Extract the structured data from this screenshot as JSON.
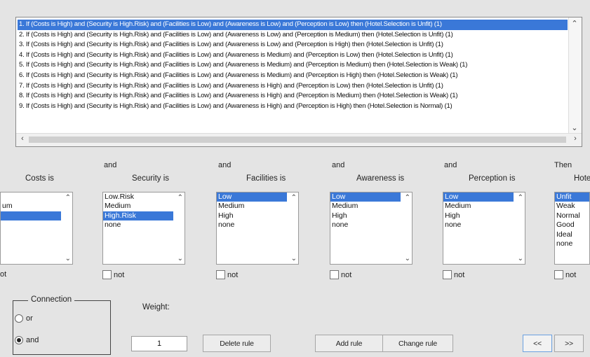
{
  "rules": {
    "items": [
      "1. If (Costs is High) and (Security is High.Risk) and (Facilities is Low) and (Awareness is Low) and (Perception is Low) then (Hotel.Selection is Unfit) (1)",
      "2. If (Costs is High) and (Security is High.Risk) and (Facilities is Low) and (Awareness is Low) and (Perception is Medium) then (Hotel.Selection is Unfit) (1)",
      "3. If (Costs is High) and (Security is High.Risk) and (Facilities is Low) and (Awareness is Low) and (Perception is High) then (Hotel.Selection is Unfit) (1)",
      "4. If (Costs is High) and (Security is High.Risk) and (Facilities is Low) and (Awareness is Medium) and (Perception is Low) then (Hotel.Selection is Unfit) (1)",
      "5. If (Costs is High) and (Security is High.Risk) and (Facilities is Low) and (Awareness is Medium) and (Perception is Medium) then (Hotel.Selection is Weak) (1)",
      "6. If (Costs is High) and (Security is High.Risk) and (Facilities is Low) and (Awareness is Medium) and (Perception is High) then (Hotel.Selection is Weak) (1)",
      "7. If (Costs is High) and (Security is High.Risk) and (Facilities is Low) and (Awareness is High) and (Perception is Low) then (Hotel.Selection is Unfit) (1)",
      "8. If (Costs is High) and (Security is High.Risk) and (Facilities is Low) and (Awareness is High) and (Perception is Medium) then (Hotel.Selection is Weak) (1)",
      "9. If (Costs is High) and (Security is High.Risk) and (Facilities is Low) and (Awareness is High) and (Perception is High) then (Hotel.Selection is Normal) (1)"
    ],
    "selected_index": 0
  },
  "columns": {
    "costs": {
      "title": "Costs is",
      "options": [
        "",
        "um",
        ""
      ],
      "selected": 2,
      "not_label": "ot"
    },
    "security": {
      "header": "and",
      "title": "Security is",
      "options": [
        "Low.Risk",
        "Medium",
        "High.Risk",
        "none"
      ],
      "selected": 2,
      "not_label": "not"
    },
    "facilities": {
      "header": "and",
      "title": "Facilities is",
      "options": [
        "Low",
        "Medium",
        "High",
        "none"
      ],
      "selected": 0,
      "not_label": "not"
    },
    "awareness": {
      "header": "and",
      "title": "Awareness is",
      "options": [
        "Low",
        "Medium",
        "High",
        "none"
      ],
      "selected": 0,
      "not_label": "not"
    },
    "perception": {
      "header": "and",
      "title": "Perception is",
      "options": [
        "Low",
        "Medium",
        "High",
        "none"
      ],
      "selected": 0,
      "not_label": "not"
    },
    "hotel": {
      "header": "Then",
      "title": "Hote",
      "options": [
        "Unfit",
        "Weak",
        "Normal",
        "Good",
        "Ideal",
        "none"
      ],
      "selected": 0,
      "not_label": "not"
    }
  },
  "connection": {
    "label": "Connection",
    "or_label": "or",
    "and_label": "and",
    "selected": "and"
  },
  "weight": {
    "label": "Weight:",
    "value": "1"
  },
  "buttons": {
    "delete": "Delete rule",
    "add": "Add rule",
    "change": "Change rule",
    "prev": "<<",
    "next": ">>"
  },
  "colors": {
    "selection": "#3a78d8",
    "background": "#e4e4e4"
  }
}
